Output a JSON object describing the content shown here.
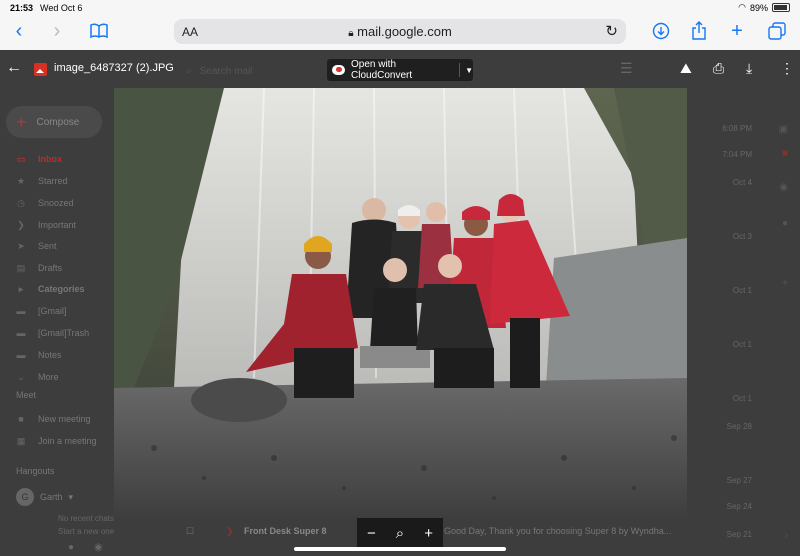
{
  "status_bar": {
    "time": "21:53",
    "date": "Wed Oct 6",
    "battery": "89%"
  },
  "safari": {
    "text_size_label": "AA",
    "url": "mail.google.com"
  },
  "viewer": {
    "file_name": "image_6487327 (2).JPG",
    "open_with_label": "Open with CloudConvert"
  },
  "gmail": {
    "search_placeholder": "Search mail",
    "compose_label": "Compose",
    "nav": [
      {
        "label": "Inbox"
      },
      {
        "label": "Starred"
      },
      {
        "label": "Snoozed"
      },
      {
        "label": "Important"
      },
      {
        "label": "Sent"
      },
      {
        "label": "Drafts"
      },
      {
        "label": "Categories"
      },
      {
        "label": "[Gmail]"
      },
      {
        "label": "[Gmail]Trash"
      },
      {
        "label": "Notes"
      },
      {
        "label": "More"
      }
    ],
    "meet_heading": "Meet",
    "meet_items": [
      {
        "label": "New meeting"
      },
      {
        "label": "Join a meeting"
      }
    ],
    "hangouts_heading": "Hangouts",
    "hangouts_user": "Garth",
    "hangouts_avatar": "G",
    "hangouts_empty_1": "No recent chats",
    "hangouts_empty_2": "Start a new one",
    "times": [
      "6:08 PM",
      "7:04 PM",
      "Oct 4",
      "Oct 3",
      "Oct 1",
      "Oct 1",
      "Oct 1",
      "Sep 28",
      "Sep 27",
      "Sep 24",
      "Sep 21"
    ],
    "bottom_row": {
      "sender": "Front Desk Super 8",
      "snippet": "Good Day, Thank you for choosing Super 8 by Wyndha..."
    }
  },
  "icons": {
    "back": "chevron-left-icon",
    "forward": "chevron-right-icon",
    "bookmarks": "book-icon",
    "lock": "lock-icon",
    "reload": "reload-icon",
    "download": "download-icon",
    "share": "share-icon",
    "new_tab": "plus-icon",
    "tabs": "tabs-icon",
    "add_to_drive": "add-to-drive-icon",
    "print": "print-icon",
    "more": "more-vert-icon",
    "zoom_out": "zoom-out-icon",
    "zoom_fit": "zoom-icon",
    "zoom_in": "zoom-in-icon"
  },
  "colors": {
    "safari_accent": "#1677f2",
    "gmail_red": "#d93025"
  }
}
